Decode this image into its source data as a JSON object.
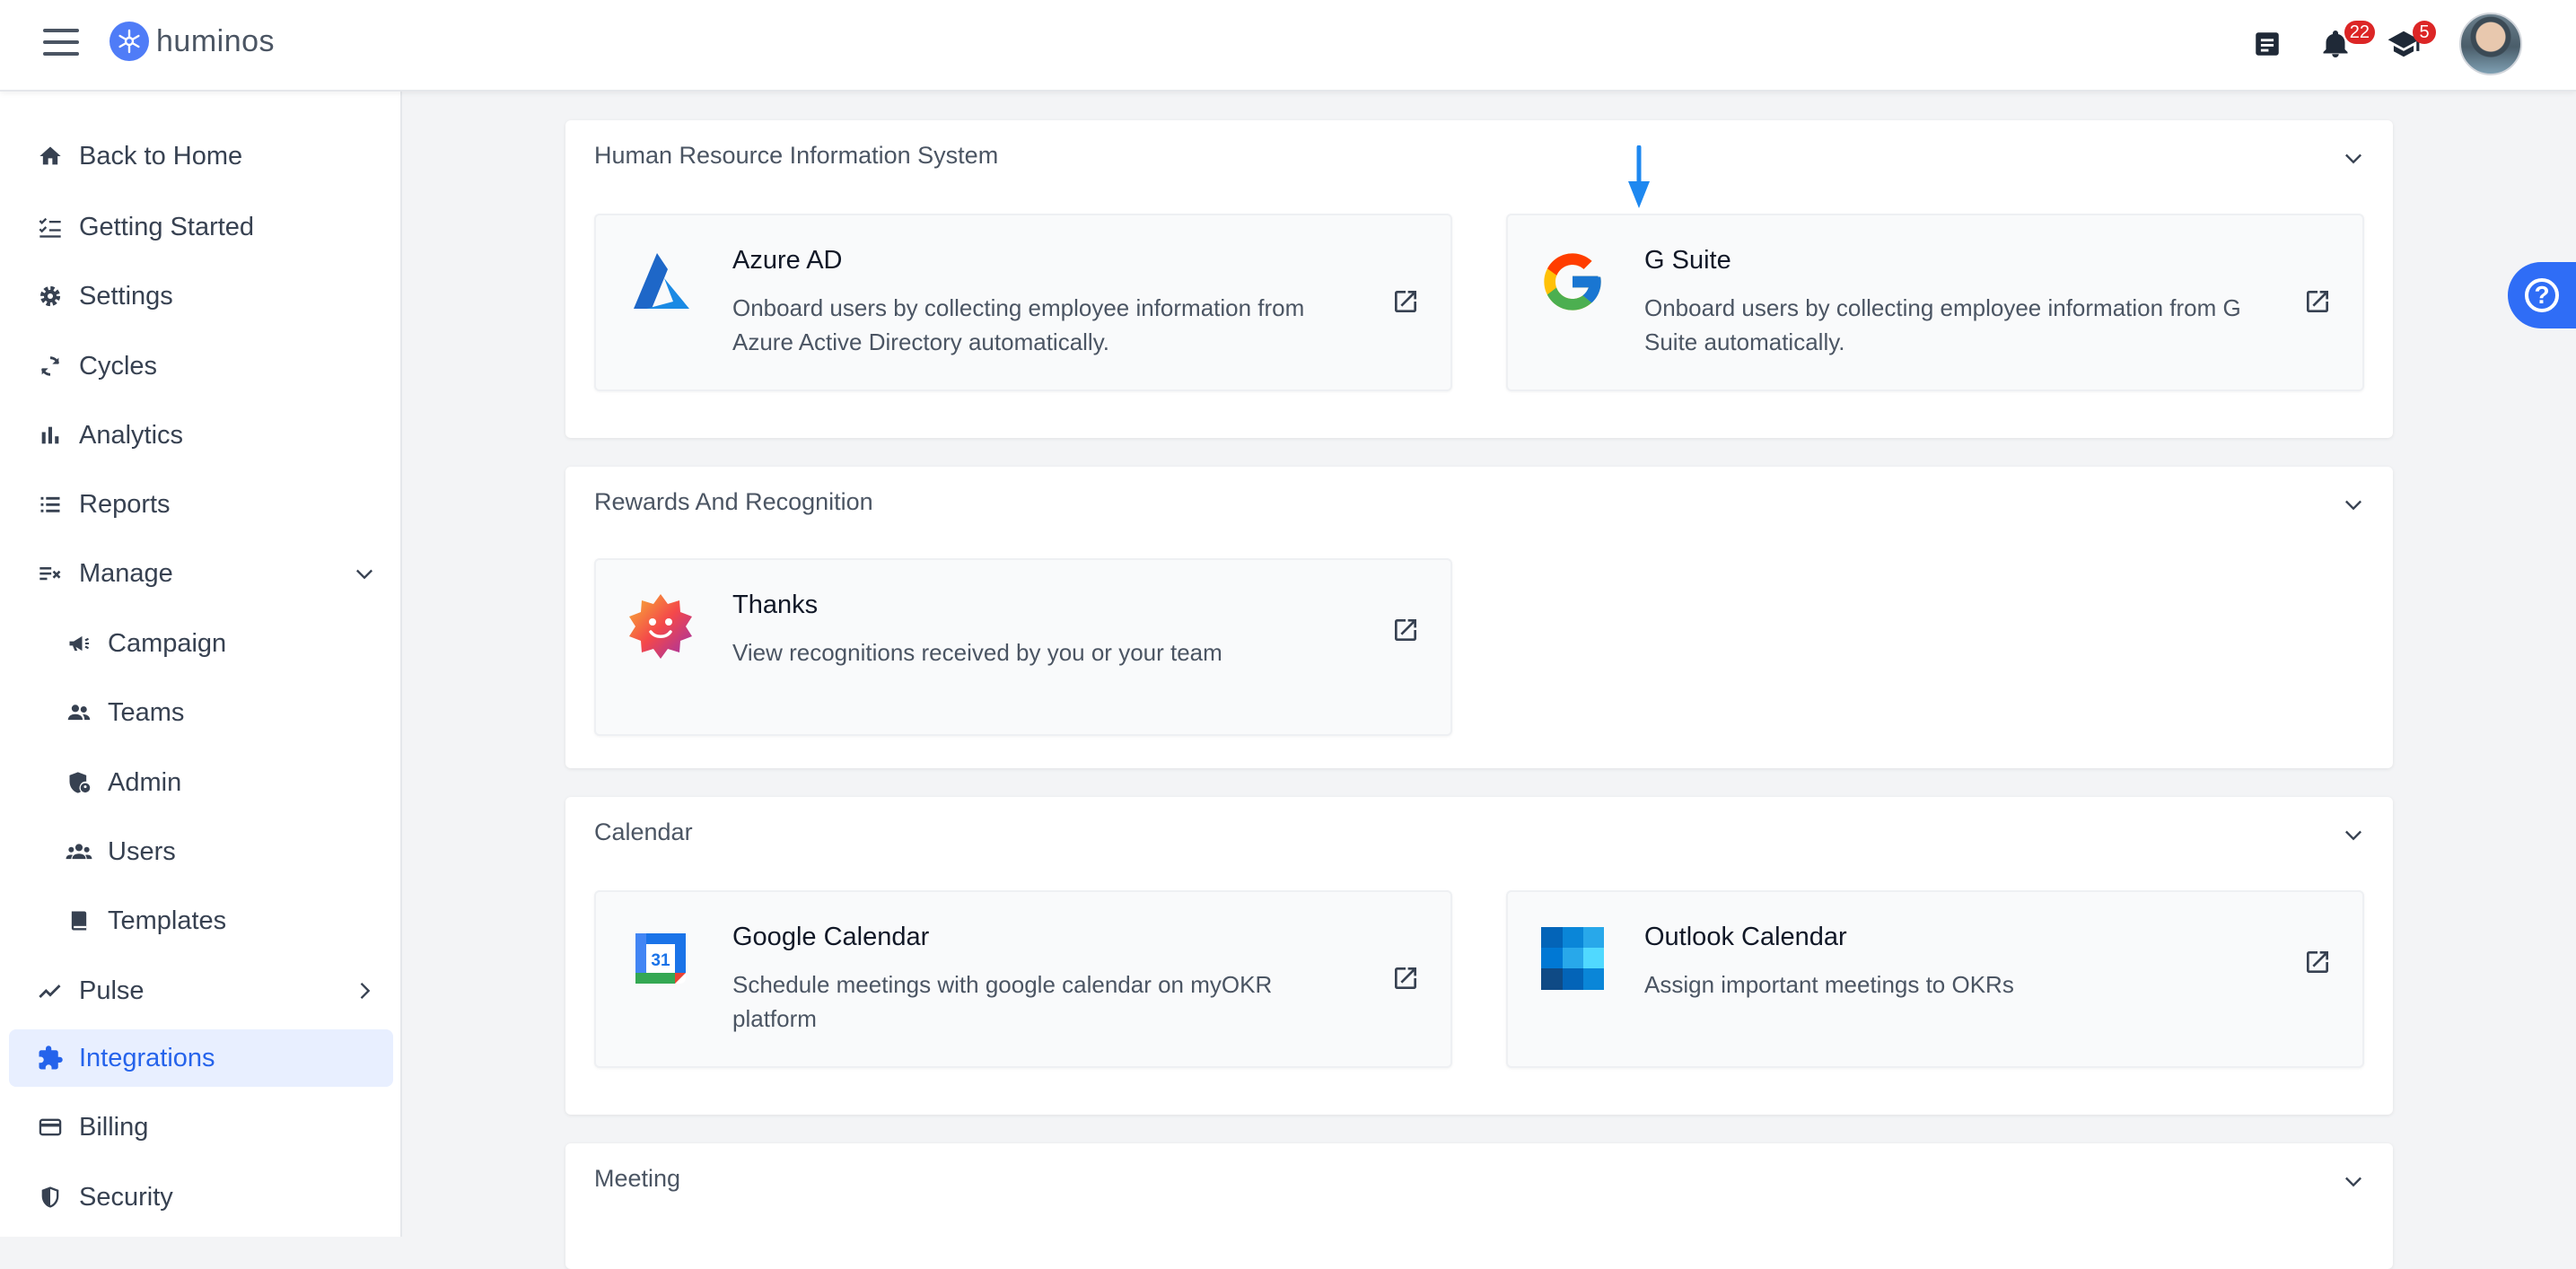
{
  "app": {
    "name": "huminos"
  },
  "header": {
    "notifications_count": "22",
    "learning_count": "5"
  },
  "sidebar": {
    "items": [
      {
        "label": "Back to Home",
        "icon": "home-icon"
      },
      {
        "label": "Getting Started",
        "icon": "checklist-icon"
      },
      {
        "label": "Settings",
        "icon": "gear-icon"
      },
      {
        "label": "Cycles",
        "icon": "cycle-icon"
      },
      {
        "label": "Analytics",
        "icon": "bar-chart-icon"
      },
      {
        "label": "Reports",
        "icon": "list-icon"
      },
      {
        "label": "Manage",
        "icon": "manage-icon"
      },
      {
        "label": "Campaign",
        "icon": "megaphone-icon"
      },
      {
        "label": "Teams",
        "icon": "team-icon"
      },
      {
        "label": "Admin",
        "icon": "admin-shield-icon"
      },
      {
        "label": "Users",
        "icon": "users-icon"
      },
      {
        "label": "Templates",
        "icon": "book-icon"
      },
      {
        "label": "Pulse",
        "icon": "trend-icon"
      },
      {
        "label": "Integrations",
        "icon": "puzzle-icon",
        "active": true
      },
      {
        "label": "Billing",
        "icon": "card-icon"
      },
      {
        "label": "Security",
        "icon": "shield-icon"
      }
    ]
  },
  "sections": [
    {
      "title": "Human Resource Information System",
      "cards": [
        {
          "title": "Azure AD",
          "description": "Onboard users by collecting employee information from Azure Active Directory automatically."
        },
        {
          "title": "G Suite",
          "description": "Onboard users by collecting employee information from G Suite automatically."
        }
      ]
    },
    {
      "title": "Rewards And Recognition",
      "cards": [
        {
          "title": "Thanks",
          "description": "View recognitions received by you or your team"
        }
      ]
    },
    {
      "title": "Calendar",
      "cards": [
        {
          "title": "Google Calendar",
          "description": "Schedule meetings with google calendar on myOKR platform",
          "logo_text": "31"
        },
        {
          "title": "Outlook Calendar",
          "description": "Assign important meetings to OKRs"
        }
      ]
    },
    {
      "title": "Meeting",
      "cards": []
    }
  ],
  "colors": {
    "accent": "#2563eb",
    "active_bg": "#e8efff",
    "badge": "#dc2626",
    "help": "#2f6df6"
  }
}
